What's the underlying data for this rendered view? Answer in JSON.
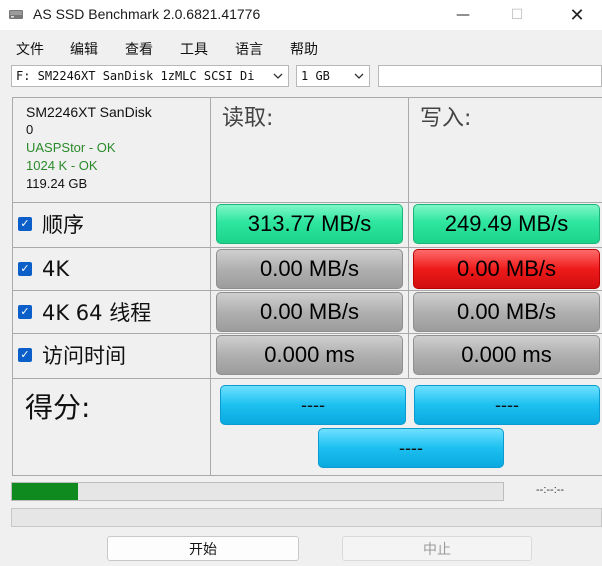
{
  "window": {
    "title": "AS SSD Benchmark 2.0.6821.41776",
    "minimize": "—",
    "maximize": "☐",
    "close": "✕"
  },
  "menu": [
    "文件",
    "编辑",
    "查看",
    "工具",
    "语言",
    "帮助"
  ],
  "selectors": {
    "drive": "F: SM2246XT SanDisk 1zMLC SCSI Di",
    "size": "1 GB",
    "extra": ""
  },
  "drive_info": {
    "name": "SM2246XT SanDisk",
    "firmware": "0",
    "driver": "UASPStor - OK",
    "alignment": "1024 K - OK",
    "capacity": "119.24 GB"
  },
  "headers": {
    "read": "读取:",
    "write": "写入:"
  },
  "rows": [
    {
      "label": "顺序",
      "read": "313.77 MB/s",
      "write": "249.49 MB/s",
      "read_color": "green",
      "write_color": "green"
    },
    {
      "label": "4K",
      "read": "0.00 MB/s",
      "write": "0.00 MB/s",
      "read_color": "gray",
      "write_color": "red"
    },
    {
      "label": "4K 64 线程",
      "read": "0.00 MB/s",
      "write": "0.00 MB/s",
      "read_color": "gray",
      "write_color": "gray"
    },
    {
      "label": "访问时间",
      "read": "0.000 ms",
      "write": "0.000 ms",
      "read_color": "gray",
      "write_color": "gray"
    }
  ],
  "score": {
    "label": "得分:",
    "read": "----",
    "write": "----",
    "total": "----"
  },
  "progress": {
    "fraction": 0.135,
    "time": "--:--:--"
  },
  "buttons": {
    "start": "开始",
    "stop": "中止"
  },
  "icons": {
    "app": "disk-icon",
    "checkbox": "checkbox-checked-icon",
    "dropdown": "chevron-down-icon"
  }
}
